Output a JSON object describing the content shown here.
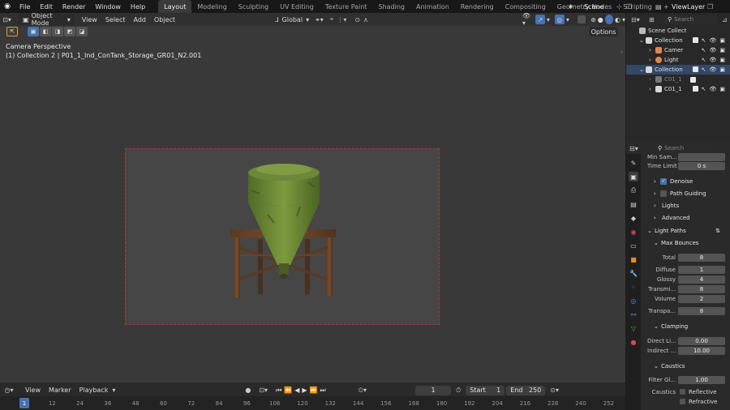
{
  "topbar": {
    "menus": [
      "File",
      "Edit",
      "Render",
      "Window",
      "Help"
    ],
    "workspaces": [
      "Layout",
      "Modeling",
      "Sculpting",
      "UV Editing",
      "Texture Paint",
      "Shading",
      "Animation",
      "Rendering",
      "Compositing",
      "Geometry Nodes",
      "Scripting"
    ],
    "active_workspace": "Layout",
    "add_tab": "+",
    "scene": "Scene",
    "view_layer": "ViewLayer"
  },
  "viewport_header": {
    "mode": "Object Mode",
    "menus": [
      "View",
      "Select",
      "Add",
      "Object"
    ],
    "transform_orientation": "Global",
    "options": "Options"
  },
  "viewport": {
    "camera_label": "Camera Perspective",
    "object_label": "(1) Collection 2 | P01_1_Ind_ConTank_Storage_GR01_N2.001"
  },
  "outliner": {
    "search_placeholder": "Search",
    "root": "Scene Collect",
    "rows": [
      {
        "label": "Collection"
      },
      {
        "label": "Camer"
      },
      {
        "label": "Light"
      },
      {
        "label": "Collection"
      },
      {
        "label": "C01_1"
      },
      {
        "label": "C01_1"
      }
    ]
  },
  "properties": {
    "search_placeholder": "Search",
    "min_samples_label": "Min Sam...",
    "time_limit_label": "Time Limit",
    "time_limit_value": "0 s",
    "denoise": "Denoise",
    "path_guiding": "Path Guiding",
    "lights": "Lights",
    "advanced": "Advanced",
    "light_paths": "Light Paths",
    "max_bounces": "Max Bounces",
    "bounces": [
      {
        "label": "Total",
        "value": "8"
      },
      {
        "label": "Diffuse",
        "value": "1"
      },
      {
        "label": "Glossy",
        "value": "4"
      },
      {
        "label": "Transmi...",
        "value": "8"
      },
      {
        "label": "Volume",
        "value": "2"
      },
      {
        "label": "Transpa...",
        "value": "8"
      }
    ],
    "clamping": "Clamping",
    "direct_label": "Direct Li...",
    "direct_value": "0.00",
    "indirect_label": "Indirect ...",
    "indirect_value": "10.00",
    "caustics": "Caustics",
    "filter_label": "Filter Gl...",
    "filter_value": "1.00",
    "caustics_label": "Caustics",
    "reflective": "Reflective",
    "refractive": "Refractive"
  },
  "timeline": {
    "menus": [
      "View",
      "Marker",
      "Playback"
    ],
    "current_frame": "1",
    "start_label": "Start",
    "start_value": "1",
    "end_label": "End",
    "end_value": "250",
    "ruler": [
      "1",
      "12",
      "24",
      "36",
      "48",
      "60",
      "72",
      "84",
      "96",
      "108",
      "120",
      "132",
      "144",
      "156",
      "168",
      "180",
      "192",
      "204",
      "216",
      "228",
      "240",
      "252"
    ]
  }
}
